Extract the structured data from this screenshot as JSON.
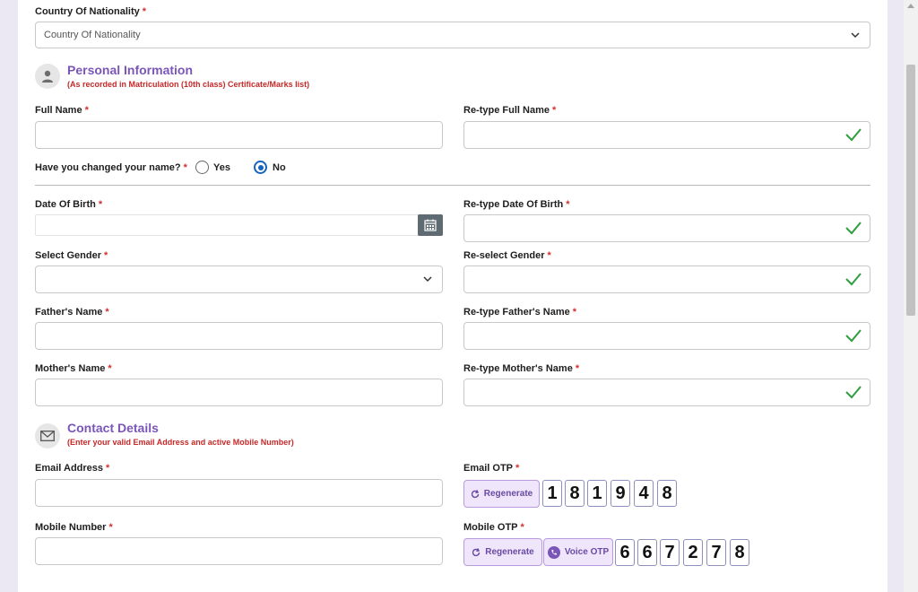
{
  "nationality": {
    "label": "Country Of Nationality",
    "placeholder": "Country Of Nationality"
  },
  "personal": {
    "title": "Personal Information",
    "subtitle": "(As recorded in Matriculation (10th class) Certificate/Marks list)",
    "full_name": "Full Name",
    "retype_full_name": "Re-type Full Name",
    "changed_name_q": "Have you changed your name?",
    "yes": "Yes",
    "no": "No",
    "selected_option": "No",
    "dob": "Date Of Birth",
    "retype_dob": "Re-type Date Of Birth",
    "gender": "Select Gender",
    "reselect_gender": "Re-select Gender",
    "father": "Father's Name",
    "retype_father": "Re-type Father's Name",
    "mother": "Mother's Name",
    "retype_mother": "Re-type Mother's Name"
  },
  "contact": {
    "title": "Contact Details",
    "subtitle": "(Enter your valid Email Address and active Mobile Number)",
    "email": "Email Address",
    "email_otp": "Email OTP",
    "mobile": "Mobile Number",
    "mobile_otp": "Mobile OTP",
    "regenerate": "Regenerate",
    "voice_otp": "Voice OTP",
    "email_otp_digits": [
      "1",
      "8",
      "1",
      "9",
      "4",
      "8"
    ],
    "mobile_otp_digits": [
      "6",
      "6",
      "7",
      "2",
      "7",
      "8"
    ]
  },
  "required_mark": "*",
  "colors": {
    "accent": "#7a56b8",
    "required": "#d32f2f",
    "check": "#2e9e3f",
    "radio": "#1565c0"
  }
}
